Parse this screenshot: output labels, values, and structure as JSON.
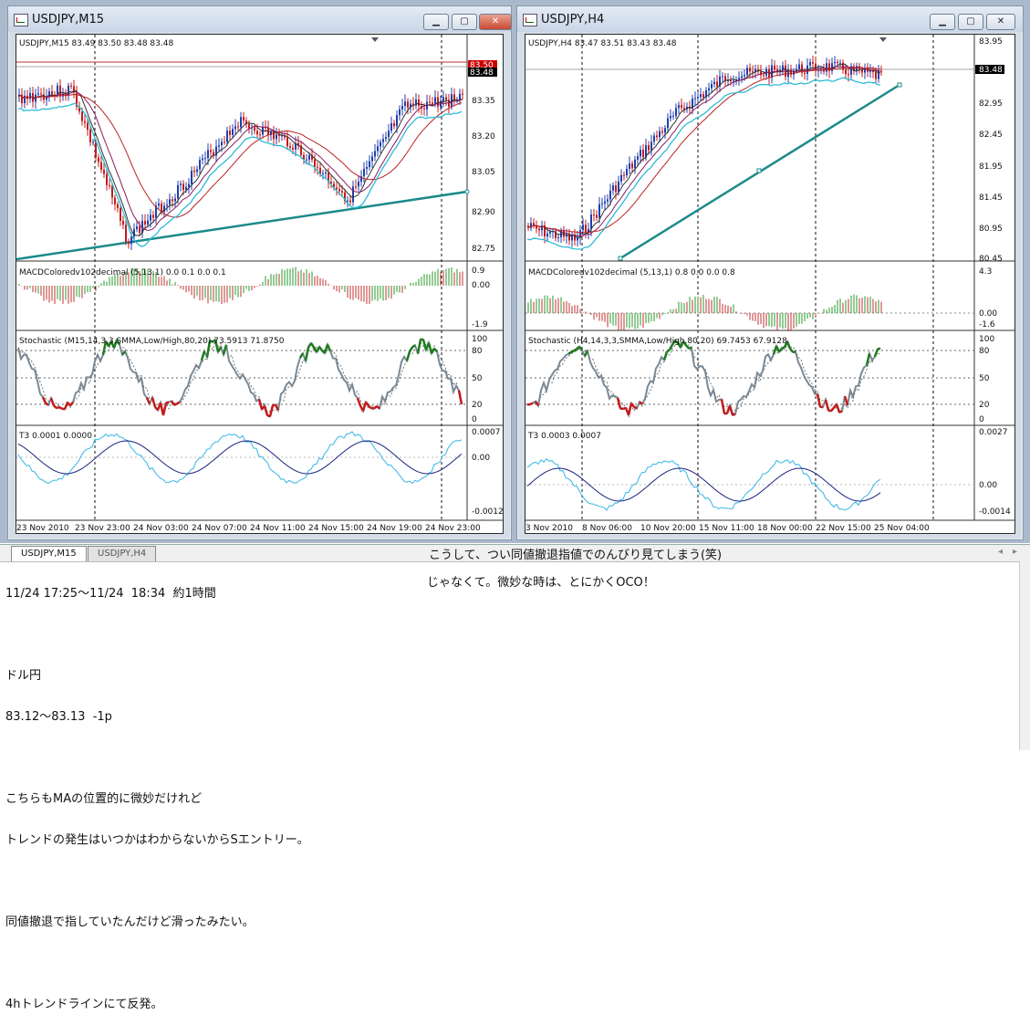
{
  "left_window": {
    "title": "USDJPY,M15",
    "price_info": "USDJPY,M15  83.49 83.50 83.48 83.48",
    "price_labels": [
      "83.50",
      "83.35",
      "83.20",
      "83.05",
      "82.90",
      "82.75"
    ],
    "current_price": "83.48",
    "macd_info": "MACDColoredv102decimal (5,13,1) 0.0 0.1 0.0 0.1",
    "macd_labels": [
      "0.9",
      "0.00",
      "-1.9"
    ],
    "stoch_info": "Stochastic (M15,14,3,3,SMMA,Low/High,80,20) 73.5913 71.8750",
    "stoch_labels": [
      "100",
      "80",
      "50",
      "20",
      "0"
    ],
    "t3_info": "T3 0.0001 0.0000",
    "t3_labels": [
      "0.0007",
      "0.00",
      "-0.0012"
    ],
    "time_labels": [
      "23 Nov 2010",
      "23 Nov 23:00",
      "24 Nov 03:00",
      "24 Nov 07:00",
      "24 Nov 11:00",
      "24 Nov 15:00",
      "24 Nov 19:00",
      "24 Nov 23:00"
    ]
  },
  "right_window": {
    "title": "USDJPY,H4",
    "price_info": "USDJPY,H4  83.47 83.51 83.43 83.48",
    "price_labels": [
      "83.95",
      "83.48",
      "82.95",
      "82.45",
      "81.95",
      "81.45",
      "80.95",
      "80.45"
    ],
    "current_price": "83.48",
    "macd_info": "MACDColoredv102decimal (5,13,1) 0.8 0.0 0.0 0.8",
    "macd_labels": [
      "4.3",
      "0.00",
      "-1.6"
    ],
    "stoch_info": "Stochastic (H4,14,3,3,SMMA,Low/High,80,20) 69.7453 67.9128",
    "stoch_labels": [
      "100",
      "80",
      "50",
      "20",
      "0"
    ],
    "t3_info": "T3 0.0003 0.0007",
    "t3_labels": [
      "0.0027",
      "0.00",
      "-0.0014"
    ],
    "time_labels": [
      "3 Nov 2010",
      "8 Nov 06:00",
      "10 Nov 20:00",
      "15 Nov 11:00",
      "18 Nov 00:00",
      "22 Nov 15:00",
      "25 Nov 04:00"
    ]
  },
  "tabs": [
    "USDJPY,M15",
    "USDJPY,H4"
  ],
  "notes": {
    "line1": "11/24 17:25～11/24  18:34  約1時間",
    "line2": "",
    "line3": "ドル円",
    "line4": "83.12～83.13  -1p",
    "line5": "",
    "line6": "こちらもMAの位置的に微妙だけれど",
    "line7": "トレンドの発生はいつかはわからないからSエントリー。",
    "line8": "",
    "line9": "同値撤退で指していたんだけど滑ったみたい。",
    "line10": "",
    "line11": "4hトレンドラインにて反発。"
  },
  "center_text": {
    "line1": "こうして、つい同値撤退指値でのんびり見てしまう(笑)",
    "line2": "じゃなくて。微妙な時は、とにかくOCO！"
  },
  "colors": {
    "bull": "#1f3fae",
    "bear": "#c41b1b",
    "trendline": "#1b8a8a",
    "stoch": "#7a8894",
    "stoch_up": "#1f7a1f",
    "stoch_dn": "#c41b1b"
  }
}
